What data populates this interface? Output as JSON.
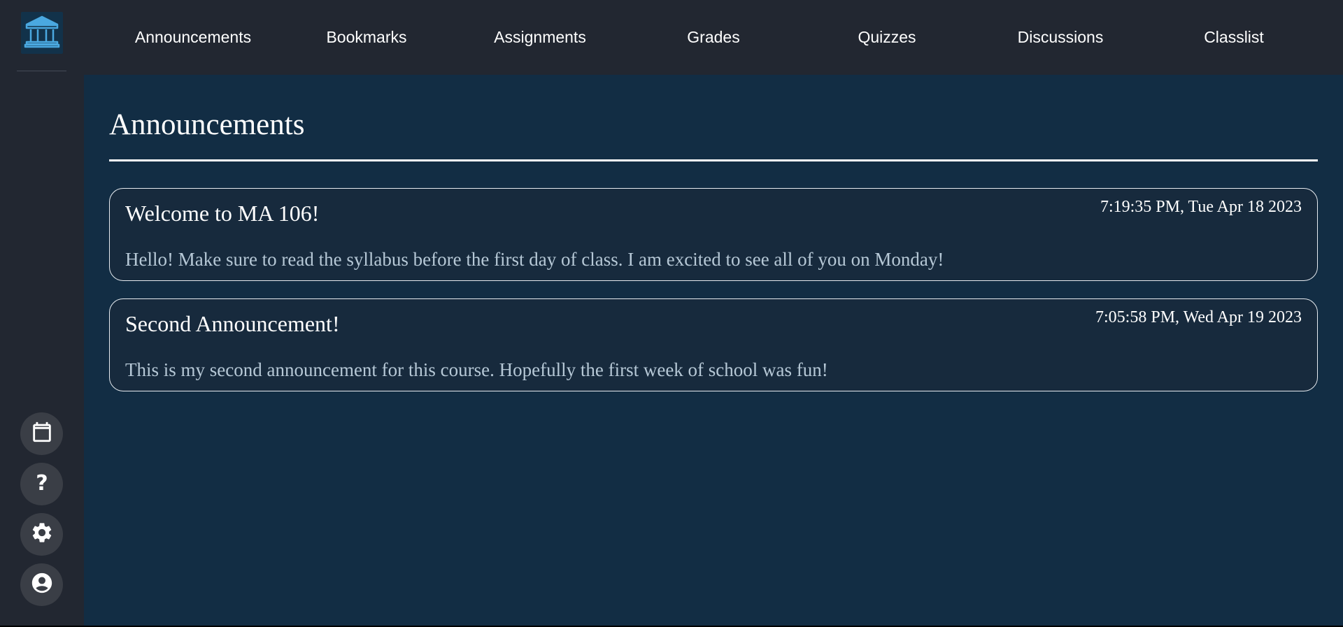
{
  "nav": {
    "items": [
      {
        "label": "Announcements"
      },
      {
        "label": "Bookmarks"
      },
      {
        "label": "Assignments"
      },
      {
        "label": "Grades"
      },
      {
        "label": "Quizzes"
      },
      {
        "label": "Discussions"
      },
      {
        "label": "Classlist"
      }
    ]
  },
  "sidebar": {
    "logo_icon": "university-building-icon",
    "buttons": [
      {
        "icon": "calendar-icon"
      },
      {
        "icon": "help-icon"
      },
      {
        "icon": "gear-icon"
      },
      {
        "icon": "account-icon"
      }
    ]
  },
  "main": {
    "title": "Announcements",
    "announcements": [
      {
        "title": "Welcome to MA 106!",
        "timestamp": "7:19:35 PM, Tue Apr 18 2023",
        "body": "Hello! Make sure to read the syllabus before the first day of class. I am excited to see all of you on Monday!"
      },
      {
        "title": "Second Announcement!",
        "timestamp": "7:05:58 PM, Wed Apr 19 2023",
        "body": "This is my second announcement for this course. Hopefully the first week of school was fun!"
      }
    ]
  },
  "colors": {
    "sidebar_bg": "#222731",
    "main_bg": "#122d44",
    "card_bg": "#172a3d",
    "logo_accent": "#4aa8e0",
    "body_text": "#b6c8d6"
  }
}
